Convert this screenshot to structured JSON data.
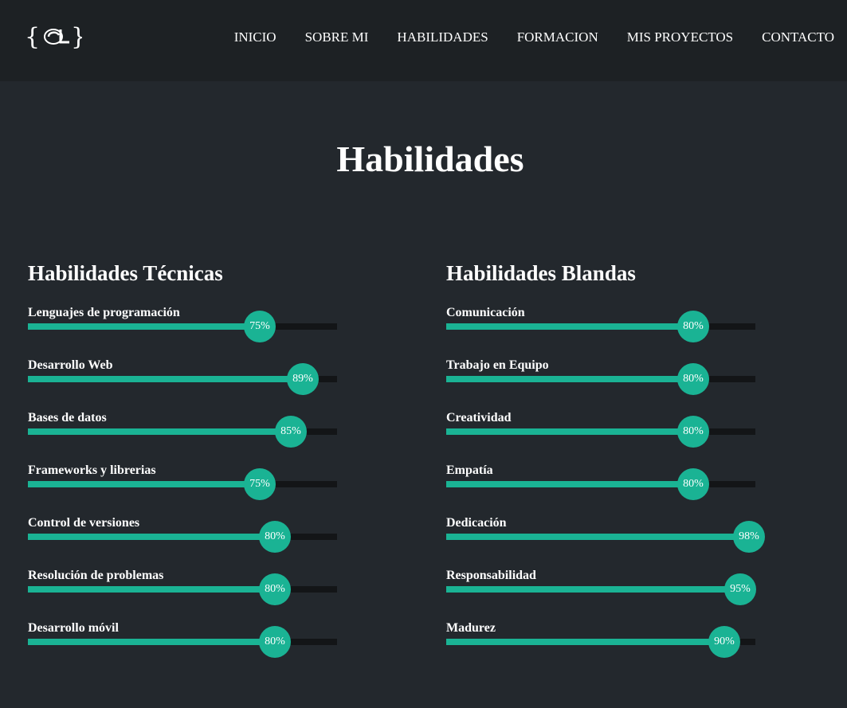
{
  "nav": {
    "links": [
      "INICIO",
      "SOBRE MI",
      "HABILIDADES",
      "FORMACION",
      "MIS PROYECTOS",
      "CONTACTO"
    ]
  },
  "page_title": "Habilidades",
  "colors": {
    "accent": "#1ab394",
    "background": "#23282d",
    "navbar": "#1d2124",
    "track": "#131517"
  },
  "technical": {
    "title": "Habilidades Técnicas",
    "skills": [
      {
        "label": "Lenguajes de programación",
        "percent": 75,
        "percent_text": "75%"
      },
      {
        "label": "Desarrollo Web",
        "percent": 89,
        "percent_text": "89%"
      },
      {
        "label": "Bases de datos",
        "percent": 85,
        "percent_text": "85%"
      },
      {
        "label": "Frameworks y librerias",
        "percent": 75,
        "percent_text": "75%"
      },
      {
        "label": "Control de versiones",
        "percent": 80,
        "percent_text": "80%"
      },
      {
        "label": "Resolución de problemas",
        "percent": 80,
        "percent_text": "80%"
      },
      {
        "label": "Desarrollo móvil",
        "percent": 80,
        "percent_text": "80%"
      }
    ]
  },
  "soft": {
    "title": "Habilidades Blandas",
    "skills": [
      {
        "label": "Comunicación",
        "percent": 80,
        "percent_text": "80%"
      },
      {
        "label": "Trabajo en Equipo",
        "percent": 80,
        "percent_text": "80%"
      },
      {
        "label": "Creatividad",
        "percent": 80,
        "percent_text": "80%"
      },
      {
        "label": "Empatía",
        "percent": 80,
        "percent_text": "80%"
      },
      {
        "label": "Dedicación",
        "percent": 98,
        "percent_text": "98%"
      },
      {
        "label": "Responsabilidad",
        "percent": 95,
        "percent_text": "95%"
      },
      {
        "label": "Madurez",
        "percent": 90,
        "percent_text": "90%"
      }
    ]
  }
}
